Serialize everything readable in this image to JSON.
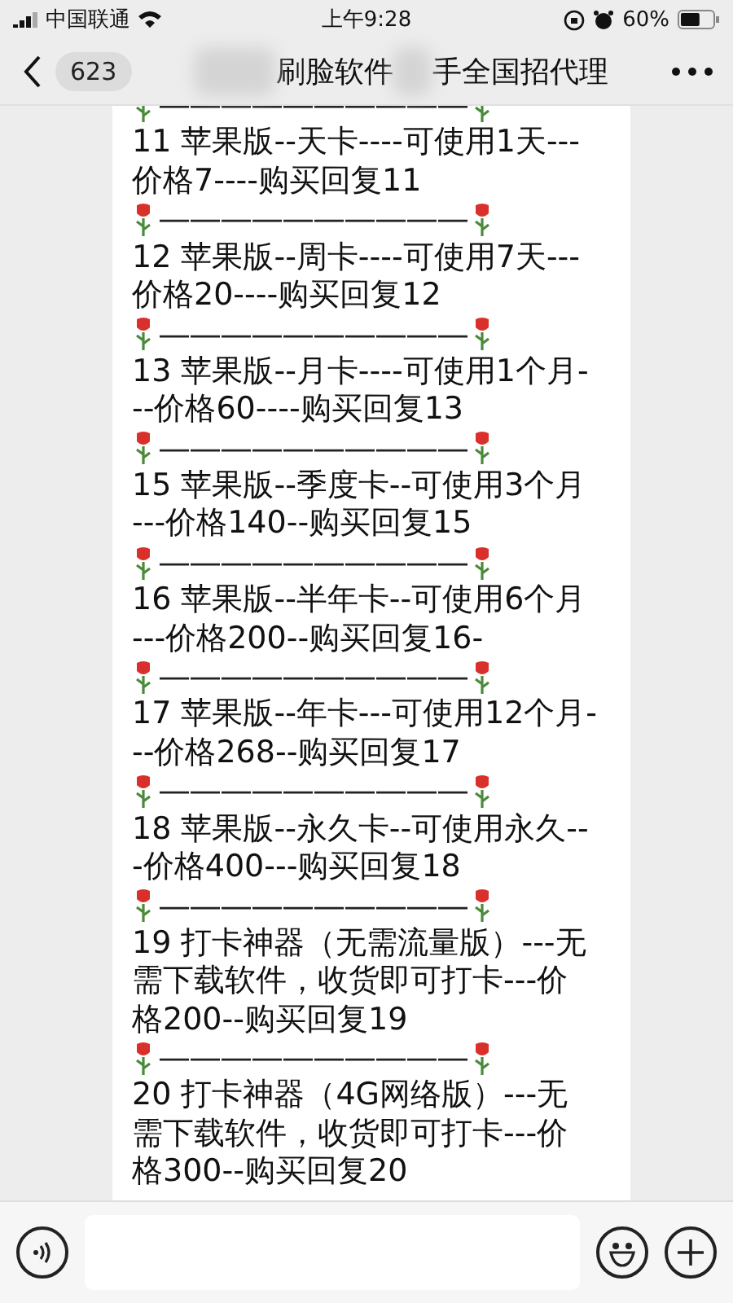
{
  "status_bar": {
    "carrier": "中国联通",
    "time": "上午9:28",
    "battery": "60%"
  },
  "header": {
    "unread": "623",
    "title_parts": [
      "刷脸软件",
      "手全国招代理"
    ]
  },
  "messages": [
    {
      "kind": "divider",
      "text": "——————————"
    },
    {
      "kind": "entry",
      "lines": [
        "11  苹果版--天卡----可使用1天---",
        "价格7----购买回复11"
      ]
    },
    {
      "kind": "divider",
      "text": "——————————"
    },
    {
      "kind": "entry",
      "lines": [
        "12  苹果版--周卡----可使用7天---",
        "价格20----购买回复12"
      ]
    },
    {
      "kind": "divider",
      "text": "——————————"
    },
    {
      "kind": "entry",
      "lines": [
        "13  苹果版--月卡----可使用1个月-",
        "--价格60----购买回复13"
      ]
    },
    {
      "kind": "divider",
      "text": "——————————"
    },
    {
      "kind": "entry",
      "lines": [
        "15  苹果版--季度卡--可使用3个月",
        "---价格140--购买回复15"
      ]
    },
    {
      "kind": "divider",
      "text": "——————————"
    },
    {
      "kind": "entry",
      "lines": [
        "16  苹果版--半年卡--可使用6个月",
        "---价格200--购买回复16-"
      ]
    },
    {
      "kind": "divider",
      "text": "——————————"
    },
    {
      "kind": "entry",
      "lines": [
        "17  苹果版--年卡---可使用12个月-",
        "--价格268--购买回复17"
      ]
    },
    {
      "kind": "divider",
      "text": "——————————"
    },
    {
      "kind": "entry",
      "lines": [
        "18  苹果版--永久卡--可使用永久--",
        "-价格400---购买回复18"
      ]
    },
    {
      "kind": "divider",
      "text": "——————————"
    },
    {
      "kind": "entry",
      "lines": [
        "19  打卡神器（无需流量版）---无",
        "需下载软件，收货即可打卡---价",
        "格200--购买回复19"
      ]
    },
    {
      "kind": "divider",
      "text": "——————————"
    },
    {
      "kind": "entry",
      "lines": [
        "20  打卡神器（4G网络版）---无",
        "需下载软件，收货即可打卡---价",
        "格300--购买回复20"
      ]
    }
  ]
}
